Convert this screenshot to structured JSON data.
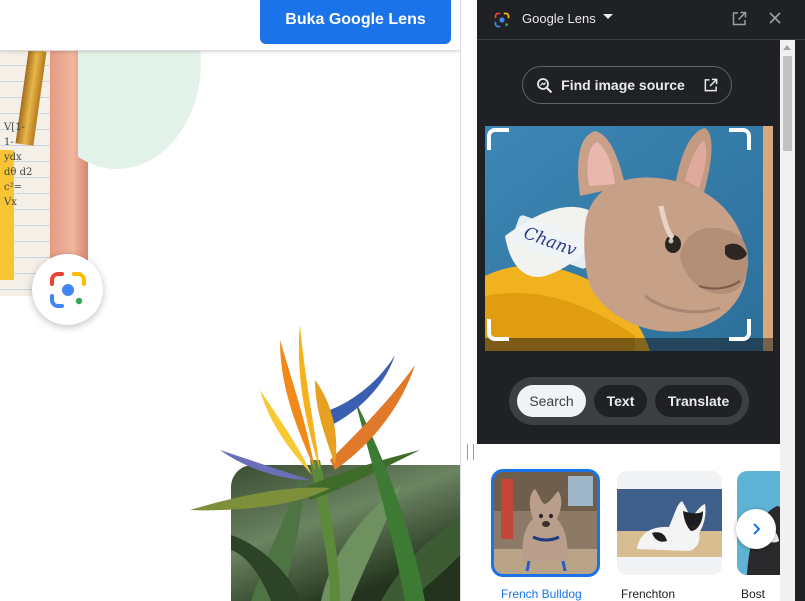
{
  "page": {
    "open_lens_button": "Buka Google Lens",
    "notebook_math": [
      "V[1-",
      "1-",
      "ydx",
      "dθ d2",
      "c²=",
      "Vx"
    ]
  },
  "lens_panel": {
    "title": "Google Lens",
    "find_source_label": "Find image source",
    "modes": {
      "search": "Search",
      "text": "Text",
      "translate": "Translate",
      "selected": "Search"
    },
    "photo_tag_text": "Chanv",
    "results": [
      {
        "label": "French Bulldog",
        "selected": true
      },
      {
        "label": "Frenchton",
        "selected": false
      },
      {
        "label": "Bost",
        "selected": false
      }
    ]
  },
  "colors": {
    "accent": "#1a73e8",
    "panel_bg": "#202124",
    "lens_blue": "#4285f4",
    "lens_red": "#ea4335",
    "lens_yellow": "#fbbc04",
    "lens_green": "#34a853"
  }
}
